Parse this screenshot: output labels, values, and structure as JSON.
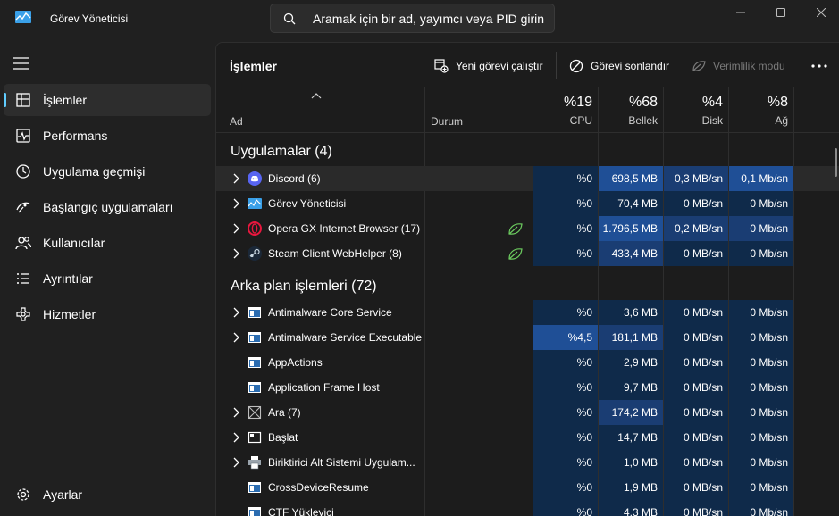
{
  "window": {
    "title": "Görev Yöneticisi"
  },
  "search": {
    "placeholder": "Aramak için bir ad, yayımcı veya PID girin"
  },
  "sidebar": {
    "items": [
      {
        "label": "İşlemler",
        "icon": "processes-icon",
        "active": true
      },
      {
        "label": "Performans",
        "icon": "performance-icon"
      },
      {
        "label": "Uygulama geçmişi",
        "icon": "app-history-icon"
      },
      {
        "label": "Başlangıç uygulamaları",
        "icon": "startup-icon"
      },
      {
        "label": "Kullanıcılar",
        "icon": "users-icon"
      },
      {
        "label": "Ayrıntılar",
        "icon": "details-icon"
      },
      {
        "label": "Hizmetler",
        "icon": "services-icon"
      }
    ],
    "settings": "Ayarlar"
  },
  "toolbar": {
    "title": "İşlemler",
    "new_task": "Yeni görevi çalıştır",
    "end_task": "Görevi sonlandır",
    "efficiency": "Verimlilik modu"
  },
  "table": {
    "col_name": "Ad",
    "col_status": "Durum",
    "cpu": {
      "pct": "%19",
      "label": "CPU"
    },
    "mem": {
      "pct": "%68",
      "label": "Bellek"
    },
    "disk": {
      "pct": "%4",
      "label": "Disk"
    },
    "net": {
      "pct": "%8",
      "label": "Ağ"
    }
  },
  "groups": {
    "apps": "Uygulamalar (4)",
    "background": "Arka plan işlemleri (72)"
  },
  "apps": [
    {
      "name": "Discord (6)",
      "cpu": "%0",
      "mem": "698,5 MB",
      "disk": "0,3 MB/sn",
      "net": "0,1 Mb/sn"
    },
    {
      "name": "Görev Yöneticisi",
      "cpu": "%0",
      "mem": "70,4 MB",
      "disk": "0 MB/sn",
      "net": "0 Mb/sn"
    },
    {
      "name": "Opera GX Internet Browser (17)",
      "cpu": "%0",
      "mem": "1.796,5 MB",
      "disk": "0,2 MB/sn",
      "net": "0 Mb/sn"
    },
    {
      "name": "Steam Client WebHelper (8)",
      "cpu": "%0",
      "mem": "433,4 MB",
      "disk": "0 MB/sn",
      "net": "0 Mb/sn"
    }
  ],
  "background": [
    {
      "name": "Antimalware Core Service",
      "cpu": "%0",
      "mem": "3,6 MB",
      "disk": "0 MB/sn",
      "net": "0 Mb/sn"
    },
    {
      "name": "Antimalware Service Executable",
      "cpu": "%4,5",
      "mem": "181,1 MB",
      "disk": "0 MB/sn",
      "net": "0 Mb/sn"
    },
    {
      "name": "AppActions",
      "cpu": "%0",
      "mem": "2,9 MB",
      "disk": "0 MB/sn",
      "net": "0 Mb/sn"
    },
    {
      "name": "Application Frame Host",
      "cpu": "%0",
      "mem": "9,7 MB",
      "disk": "0 MB/sn",
      "net": "0 Mb/sn"
    },
    {
      "name": "Ara (7)",
      "cpu": "%0",
      "mem": "174,2 MB",
      "disk": "0 MB/sn",
      "net": "0 Mb/sn"
    },
    {
      "name": "Başlat",
      "cpu": "%0",
      "mem": "14,7 MB",
      "disk": "0 MB/sn",
      "net": "0 Mb/sn"
    },
    {
      "name": "Biriktirici Alt Sistemi Uygulam...",
      "cpu": "%0",
      "mem": "1,0 MB",
      "disk": "0 MB/sn",
      "net": "0 Mb/sn"
    },
    {
      "name": "CrossDeviceResume",
      "cpu": "%0",
      "mem": "1,9 MB",
      "disk": "0 MB/sn",
      "net": "0 Mb/sn"
    },
    {
      "name": "CTF Yükleyici",
      "cpu": "%0",
      "mem": "4,3 MB",
      "disk": "0 MB/sn",
      "net": "0 Mb/sn"
    }
  ],
  "colors": {
    "accent": "#60cdff",
    "heat_low": "#0f2a4a",
    "heat_mid": "#1a3d73",
    "heat_high": "#1f4f96"
  }
}
